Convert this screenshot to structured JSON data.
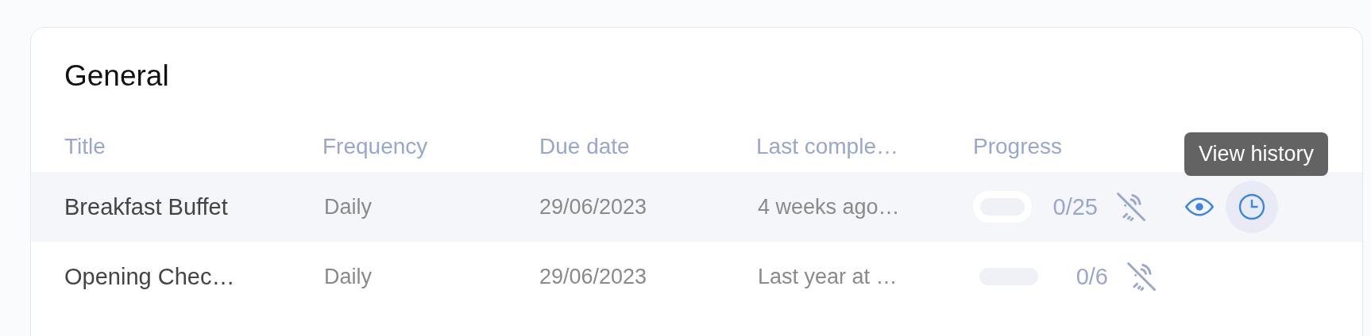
{
  "card": {
    "title": "General"
  },
  "table": {
    "columns": [
      "Title",
      "Frequency",
      "Due date",
      "Last comple…",
      "Progress"
    ],
    "rows": [
      {
        "title": "Breakfast Buffet",
        "frequency": "Daily",
        "due_date": "29/06/2023",
        "last_completed": "4 weeks ago…",
        "progress": {
          "level": 0,
          "reading": "0/25"
        },
        "highlighted": true
      },
      {
        "title": "Opening Chec…",
        "frequency": "Daily",
        "due_date": "29/06/2023",
        "last_completed": "Last year at …",
        "progress": {
          "level": 0,
          "reading": "0/6"
        },
        "highlighted": false
      }
    ]
  },
  "tooltip": {
    "text": "View history"
  }
}
